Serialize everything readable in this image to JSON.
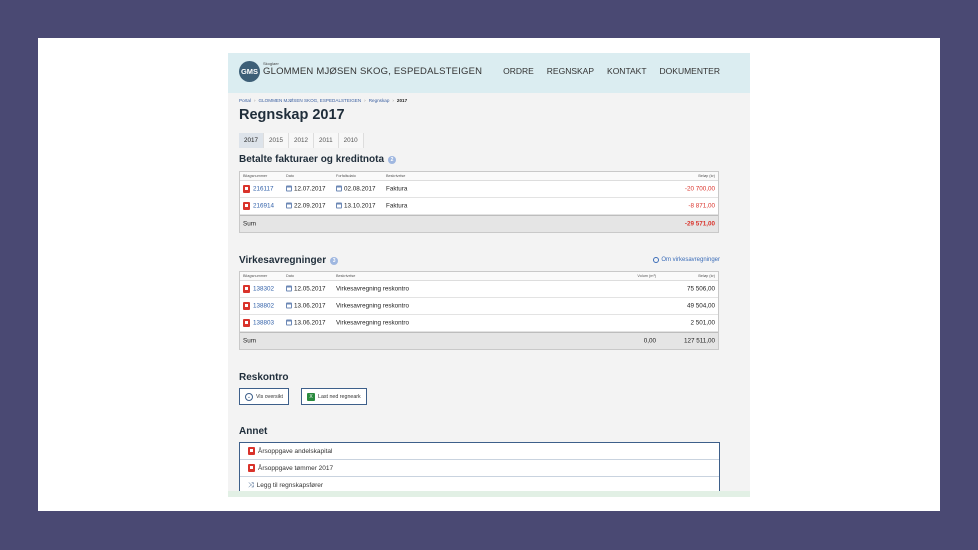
{
  "header": {
    "logo_initials": "GMS",
    "logo_small": "Skoglaer",
    "org_name": "GLOMMEN MJØSEN SKOG, ESPEDALSTEIGEN",
    "nav": [
      "ORDRE",
      "REGNSKAP",
      "KONTAKT",
      "DOKUMENTER"
    ]
  },
  "breadcrumb": [
    "Portal",
    "GLOMMEN MJØSEN SKOG, ESPEDALSTEIGEN",
    "Regnskap",
    "2017"
  ],
  "page_title": "Regnskap 2017",
  "year_tabs": [
    "2017",
    "2015",
    "2012",
    "2011",
    "2010"
  ],
  "fakturaer": {
    "title": "Betalte fakturaer og kreditnota",
    "count": "2",
    "headers": {
      "bilag": "Bilagsnummer",
      "dato": "Dato",
      "forfall": "Forfallsdato",
      "beskrivelse": "Beskrivelse",
      "belop": "Beløp (kr)"
    },
    "rows": [
      {
        "bilag": "216117",
        "dato": "12.07.2017",
        "forfall": "02.08.2017",
        "beskrivelse": "Faktura",
        "belop": "-20 700,00"
      },
      {
        "bilag": "216914",
        "dato": "22.09.2017",
        "forfall": "13.10.2017",
        "beskrivelse": "Faktura",
        "belop": "-8 871,00"
      }
    ],
    "sum_label": "Sum",
    "sum": "-29 571,00"
  },
  "virksomhet": {
    "title": "Virkesavregninger",
    "count": "3",
    "info_link": "Om virkesavregninger",
    "headers": {
      "bilag": "Bilagsnummer",
      "dato": "Dato",
      "beskrivelse": "Beskrivelse",
      "volum": "Volum (m³)",
      "belop": "Beløp (kr)"
    },
    "rows": [
      {
        "bilag": "138302",
        "dato": "12.05.2017",
        "beskrivelse": "Virkesavregning reskontro",
        "belop": "75 506,00"
      },
      {
        "bilag": "138802",
        "dato": "13.06.2017",
        "beskrivelse": "Virkesavregning reskontro",
        "belop": "49 504,00"
      },
      {
        "bilag": "138803",
        "dato": "13.06.2017",
        "beskrivelse": "Virkesavregning reskontro",
        "belop": "2 501,00"
      }
    ],
    "sum_label": "Sum",
    "sum_volum": "0,00",
    "sum": "127 511,00"
  },
  "reskontro": {
    "title": "Reskontro",
    "vis_label": "Vis oversikt",
    "download_label": "Last ned regneark",
    "xls_glyph": "X"
  },
  "annet": {
    "title": "Annet",
    "items": [
      "Årsoppgave andelskapital",
      "Årsoppgave tømmer 2017",
      "Legg til regnskapsfører"
    ]
  },
  "colors": {
    "accent": "#3d5f8a",
    "negative": "#d9332b",
    "header_bg": "#dbedf1",
    "backdrop": "#4a4973"
  }
}
